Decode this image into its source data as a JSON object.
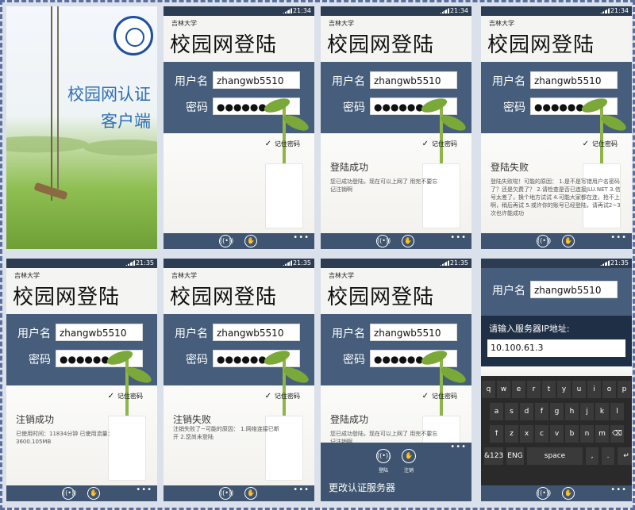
{
  "splash": {
    "title_line1": "校园网认证",
    "title_line2": "客户端"
  },
  "app": {
    "school": "吉林大学",
    "page_title": "校园网登陆",
    "user_label": "用户名",
    "pass_label": "密码",
    "username": "zhangwb5510",
    "password": "●●●●●●",
    "remember": "记住密码",
    "more": "•••"
  },
  "times": {
    "t1": "21:34",
    "t2": "21:34",
    "t3": "21:34",
    "t4": "21:35",
    "t5": "21:35",
    "t6": "21:35",
    "t7": "21:35"
  },
  "msgs": {
    "login_ok_title": "登陆成功",
    "login_ok_body": "您已成功登陆，现在可以上网了 用完不要忘记注销啊",
    "login_fail_title": "登陆失败",
    "login_fail_body": "登陆失败啦！可能的原因： 1.是不是写错用户名密码了？还是欠费了？ 2.请检查是否已连接JLU.NET 3.信号太差了，换个地方试试 4.可能大家都在连，抢不上啊，稍后再试 5.或许你的账号已经登陆，请再试2~3次也许能成功",
    "logout_ok_title": "注销成功",
    "logout_ok_body": "已使用时间：11834分钟 已使用流量：3600.105MB",
    "logout_fail_title": "注销失败",
    "logout_fail_body": "注销失败了~可能的原因： 1.网络连接已断开 2.您尚未登陆"
  },
  "appbar": {
    "login": "登陆",
    "logout": "注销",
    "menu_item": "更改认证服务器"
  },
  "dialog": {
    "title": "请输入服务器IP地址:",
    "value": "10.100.61.3"
  },
  "keyboard": {
    "row1": [
      "q",
      "w",
      "e",
      "r",
      "t",
      "y",
      "u",
      "i",
      "o",
      "p"
    ],
    "row2": [
      "a",
      "s",
      "d",
      "f",
      "g",
      "h",
      "j",
      "k",
      "l"
    ],
    "row3": [
      "↑",
      "z",
      "x",
      "c",
      "v",
      "b",
      "n",
      "m",
      "⌫"
    ],
    "row4": [
      "&123",
      "ENG",
      "space",
      ",",
      ".",
      "↵"
    ]
  }
}
